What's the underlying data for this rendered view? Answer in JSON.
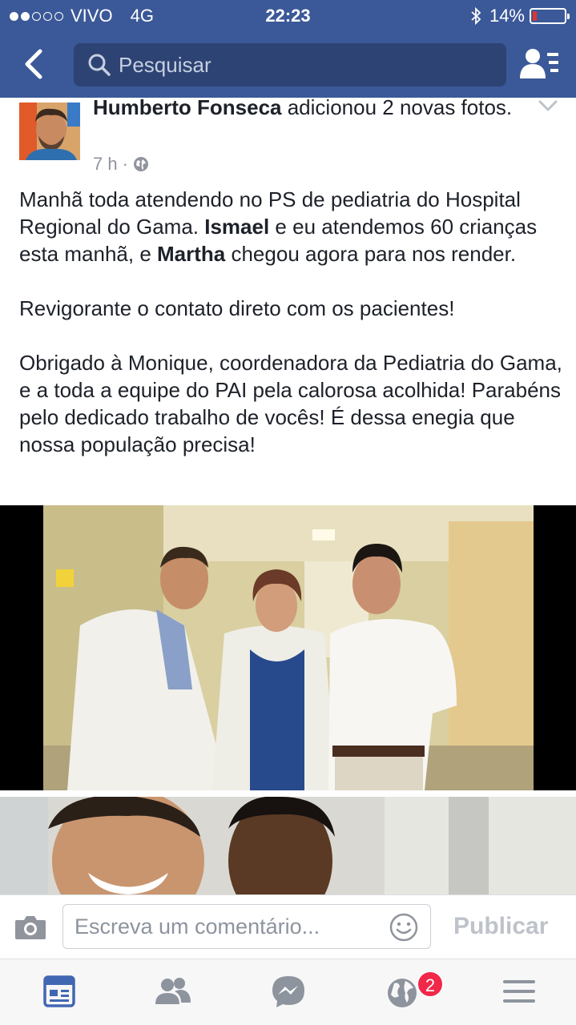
{
  "status_bar": {
    "carrier": "VIVO",
    "network": "4G",
    "time": "22:23",
    "battery": "14%",
    "battery_level": 0.14,
    "signal_bars": 2,
    "signal_total": 5
  },
  "nav": {
    "search_placeholder": "Pesquisar"
  },
  "post": {
    "author": "Humberto Fonseca",
    "action": " adicionou 2 novas fotos.",
    "time": "7 h",
    "separator": "·",
    "paragraph1_a": "Manhã toda atendendo no PS de pediatria do Hospital Regional do Gama. ",
    "mention1": "Ismael",
    "paragraph1_b": " e eu atendemos 60 crianças esta manhã, e ",
    "mention2": "Martha",
    "paragraph1_c": " chegou agora para nos render.",
    "paragraph2": "Revigorante o contato direto com os pacientes!",
    "paragraph3": "Obrigado à Monique, coordenadora da Pediatria do Gama, e a toda a equipe do PAI pela calorosa acolhida! Parabéns pelo dedicado trabalho de vocês! É dessa enegia que nossa população precisa!"
  },
  "comment_bar": {
    "placeholder": "Escreva um comentário...",
    "publish_label": "Publicar"
  },
  "tabbar": {
    "notifications_badge": "2"
  },
  "colors": {
    "brand": "#3b5998",
    "badge": "#f02849",
    "tab_active": "#4267b2",
    "tab_inactive": "#8d949e"
  }
}
